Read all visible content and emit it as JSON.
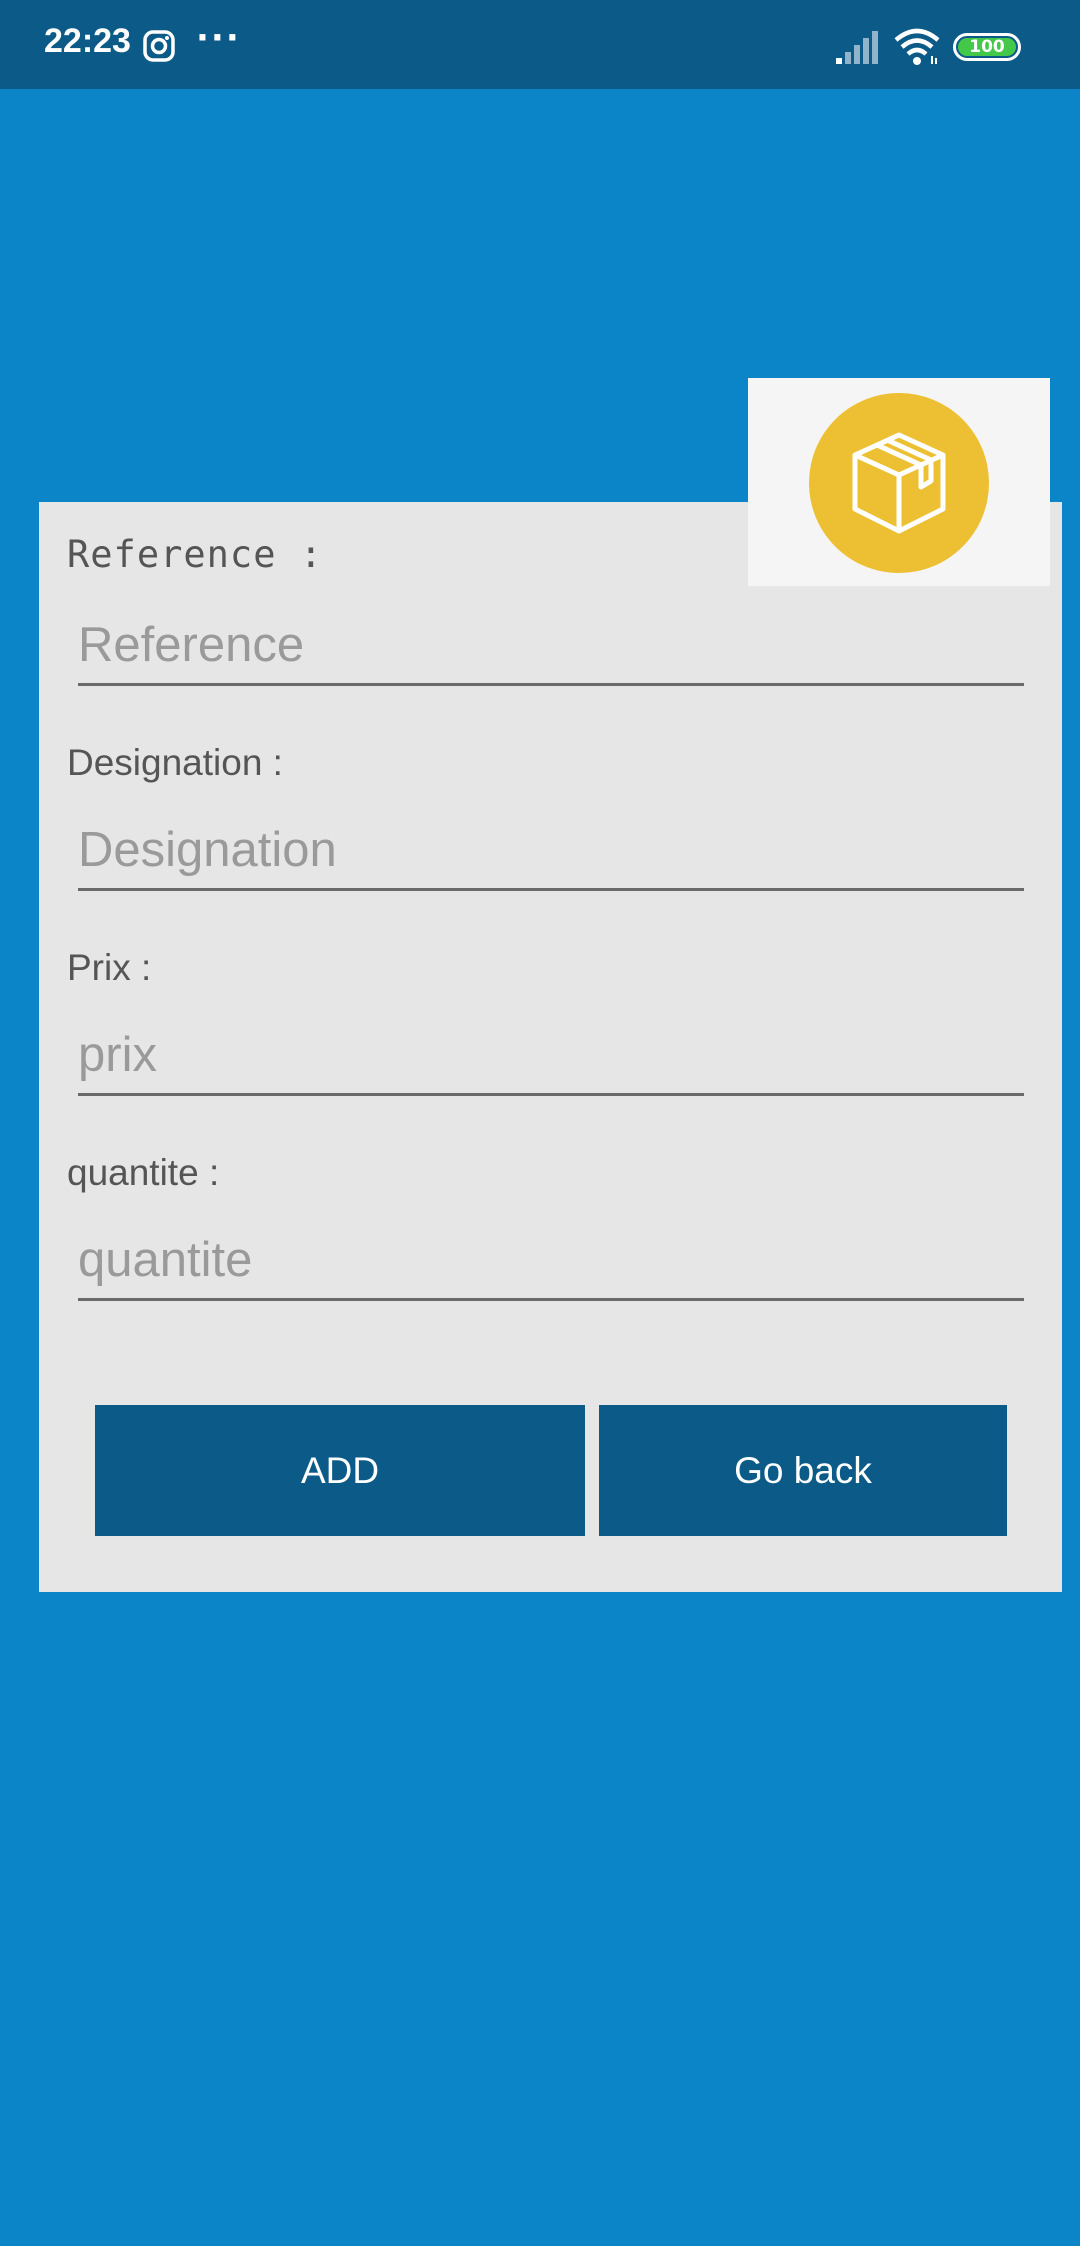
{
  "status_bar": {
    "time": "22:23",
    "more_dots": "···",
    "battery": "100",
    "icons": [
      "instagram-icon",
      "more-icon",
      "signal-icon",
      "wifi-icon",
      "battery-icon"
    ]
  },
  "logo": {
    "icon": "package-box-icon",
    "circle_color": "#ecc032"
  },
  "form": {
    "fields": [
      {
        "label": "Reference :",
        "placeholder": "Reference",
        "value": ""
      },
      {
        "label": "Designation :",
        "placeholder": "Designation",
        "value": ""
      },
      {
        "label": "Prix :",
        "placeholder": "prix",
        "value": ""
      },
      {
        "label": "quantite :",
        "placeholder": "quantite",
        "value": ""
      }
    ],
    "add_label": "ADD",
    "back_label": "Go back"
  },
  "colors": {
    "background": "#0b84c8",
    "status_bar": "#0b5a87",
    "card": "#e6e6e6",
    "button": "#0b5a87",
    "battery": "#43c84a"
  }
}
